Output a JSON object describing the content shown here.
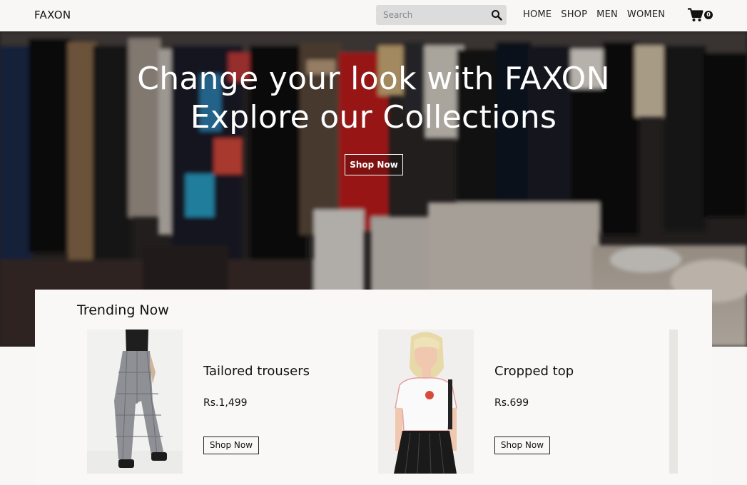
{
  "brand": "FAXON",
  "search": {
    "placeholder": "Search"
  },
  "nav": [
    "HOME",
    "SHOP",
    "MEN",
    "WOMEN"
  ],
  "cart": {
    "count": "0"
  },
  "hero": {
    "line1": "Change your look with FAXON",
    "line2": "Explore our Collections",
    "button": "Shop Now"
  },
  "trending": {
    "title": "Trending Now",
    "products": [
      {
        "name": "Tailored trousers",
        "price": "Rs.1,499",
        "button": "Shop Now"
      },
      {
        "name": "Cropped top",
        "price": "Rs.699",
        "button": "Shop Now"
      }
    ]
  },
  "icons": {
    "search": "search-icon",
    "cart": "cart-icon"
  }
}
